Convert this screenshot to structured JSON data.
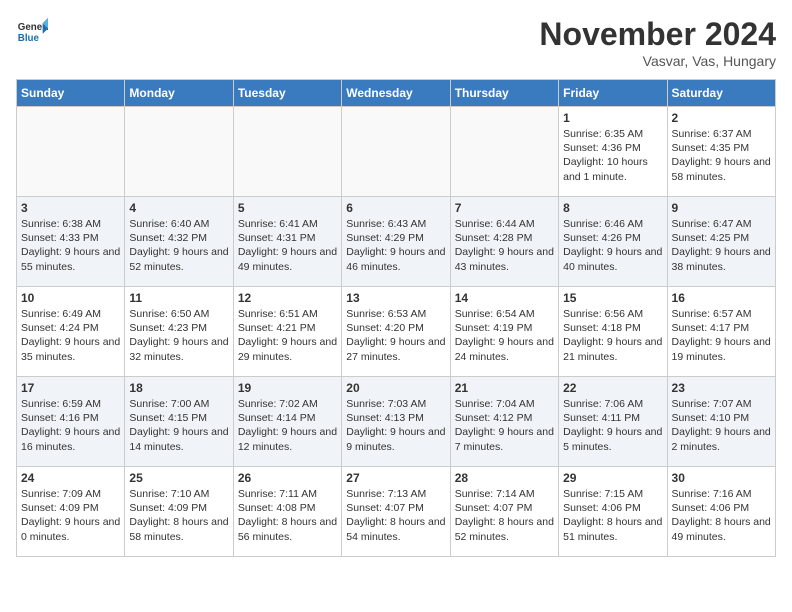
{
  "header": {
    "logo_general": "General",
    "logo_blue": "Blue",
    "title": "November 2024",
    "location": "Vasvar, Vas, Hungary"
  },
  "columns": [
    "Sunday",
    "Monday",
    "Tuesday",
    "Wednesday",
    "Thursday",
    "Friday",
    "Saturday"
  ],
  "weeks": [
    {
      "days": [
        {
          "num": "",
          "info": "",
          "empty": true
        },
        {
          "num": "",
          "info": "",
          "empty": true
        },
        {
          "num": "",
          "info": "",
          "empty": true
        },
        {
          "num": "",
          "info": "",
          "empty": true
        },
        {
          "num": "",
          "info": "",
          "empty": true
        },
        {
          "num": "1",
          "info": "Sunrise: 6:35 AM\nSunset: 4:36 PM\nDaylight: 10 hours and 1 minute."
        },
        {
          "num": "2",
          "info": "Sunrise: 6:37 AM\nSunset: 4:35 PM\nDaylight: 9 hours and 58 minutes."
        }
      ]
    },
    {
      "days": [
        {
          "num": "3",
          "info": "Sunrise: 6:38 AM\nSunset: 4:33 PM\nDaylight: 9 hours and 55 minutes."
        },
        {
          "num": "4",
          "info": "Sunrise: 6:40 AM\nSunset: 4:32 PM\nDaylight: 9 hours and 52 minutes."
        },
        {
          "num": "5",
          "info": "Sunrise: 6:41 AM\nSunset: 4:31 PM\nDaylight: 9 hours and 49 minutes."
        },
        {
          "num": "6",
          "info": "Sunrise: 6:43 AM\nSunset: 4:29 PM\nDaylight: 9 hours and 46 minutes."
        },
        {
          "num": "7",
          "info": "Sunrise: 6:44 AM\nSunset: 4:28 PM\nDaylight: 9 hours and 43 minutes."
        },
        {
          "num": "8",
          "info": "Sunrise: 6:46 AM\nSunset: 4:26 PM\nDaylight: 9 hours and 40 minutes."
        },
        {
          "num": "9",
          "info": "Sunrise: 6:47 AM\nSunset: 4:25 PM\nDaylight: 9 hours and 38 minutes."
        }
      ]
    },
    {
      "days": [
        {
          "num": "10",
          "info": "Sunrise: 6:49 AM\nSunset: 4:24 PM\nDaylight: 9 hours and 35 minutes."
        },
        {
          "num": "11",
          "info": "Sunrise: 6:50 AM\nSunset: 4:23 PM\nDaylight: 9 hours and 32 minutes."
        },
        {
          "num": "12",
          "info": "Sunrise: 6:51 AM\nSunset: 4:21 PM\nDaylight: 9 hours and 29 minutes."
        },
        {
          "num": "13",
          "info": "Sunrise: 6:53 AM\nSunset: 4:20 PM\nDaylight: 9 hours and 27 minutes."
        },
        {
          "num": "14",
          "info": "Sunrise: 6:54 AM\nSunset: 4:19 PM\nDaylight: 9 hours and 24 minutes."
        },
        {
          "num": "15",
          "info": "Sunrise: 6:56 AM\nSunset: 4:18 PM\nDaylight: 9 hours and 21 minutes."
        },
        {
          "num": "16",
          "info": "Sunrise: 6:57 AM\nSunset: 4:17 PM\nDaylight: 9 hours and 19 minutes."
        }
      ]
    },
    {
      "days": [
        {
          "num": "17",
          "info": "Sunrise: 6:59 AM\nSunset: 4:16 PM\nDaylight: 9 hours and 16 minutes."
        },
        {
          "num": "18",
          "info": "Sunrise: 7:00 AM\nSunset: 4:15 PM\nDaylight: 9 hours and 14 minutes."
        },
        {
          "num": "19",
          "info": "Sunrise: 7:02 AM\nSunset: 4:14 PM\nDaylight: 9 hours and 12 minutes."
        },
        {
          "num": "20",
          "info": "Sunrise: 7:03 AM\nSunset: 4:13 PM\nDaylight: 9 hours and 9 minutes."
        },
        {
          "num": "21",
          "info": "Sunrise: 7:04 AM\nSunset: 4:12 PM\nDaylight: 9 hours and 7 minutes."
        },
        {
          "num": "22",
          "info": "Sunrise: 7:06 AM\nSunset: 4:11 PM\nDaylight: 9 hours and 5 minutes."
        },
        {
          "num": "23",
          "info": "Sunrise: 7:07 AM\nSunset: 4:10 PM\nDaylight: 9 hours and 2 minutes."
        }
      ]
    },
    {
      "days": [
        {
          "num": "24",
          "info": "Sunrise: 7:09 AM\nSunset: 4:09 PM\nDaylight: 9 hours and 0 minutes."
        },
        {
          "num": "25",
          "info": "Sunrise: 7:10 AM\nSunset: 4:09 PM\nDaylight: 8 hours and 58 minutes."
        },
        {
          "num": "26",
          "info": "Sunrise: 7:11 AM\nSunset: 4:08 PM\nDaylight: 8 hours and 56 minutes."
        },
        {
          "num": "27",
          "info": "Sunrise: 7:13 AM\nSunset: 4:07 PM\nDaylight: 8 hours and 54 minutes."
        },
        {
          "num": "28",
          "info": "Sunrise: 7:14 AM\nSunset: 4:07 PM\nDaylight: 8 hours and 52 minutes."
        },
        {
          "num": "29",
          "info": "Sunrise: 7:15 AM\nSunset: 4:06 PM\nDaylight: 8 hours and 51 minutes."
        },
        {
          "num": "30",
          "info": "Sunrise: 7:16 AM\nSunset: 4:06 PM\nDaylight: 8 hours and 49 minutes."
        }
      ]
    }
  ]
}
